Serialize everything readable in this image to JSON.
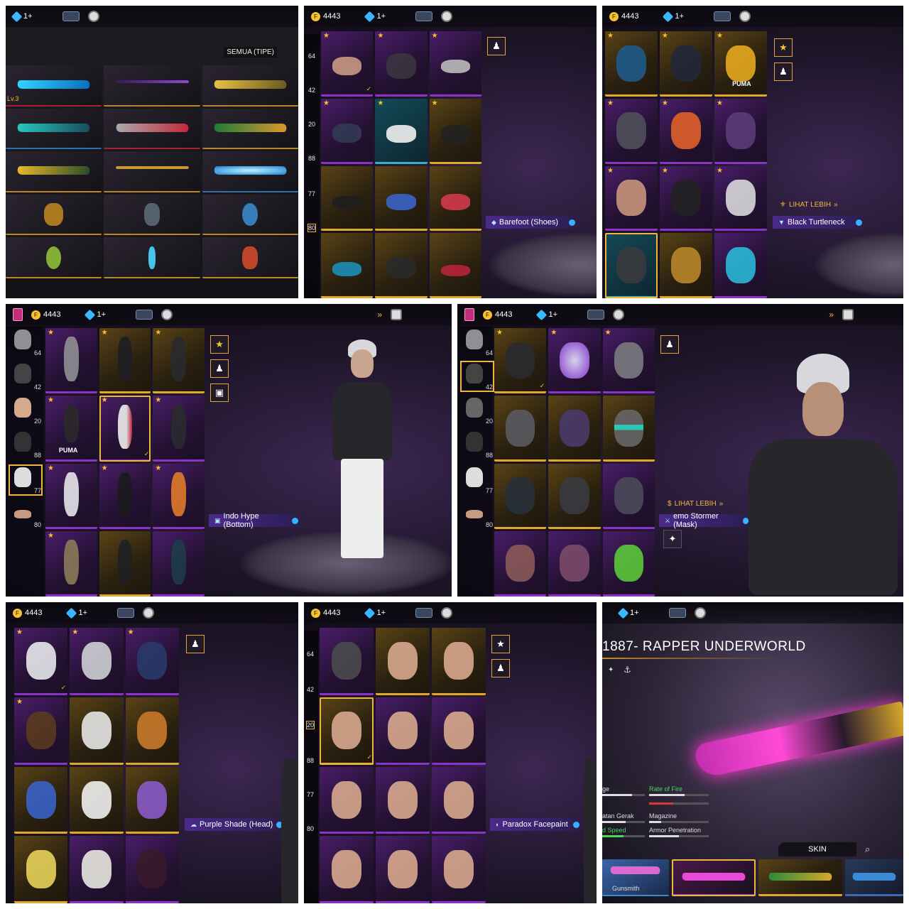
{
  "currency": {
    "coins": "4443",
    "gems": "1+",
    "coin_glyph": "F"
  },
  "panel1": {
    "filter_label": "SEMUA (TIPE)",
    "level_tag": "Lv.3"
  },
  "panel2": {
    "nums": [
      "64",
      "42",
      "20",
      "88",
      "77",
      "80"
    ],
    "selected_label": "Barefoot (Shoes)"
  },
  "panel3": {
    "see_more": "LIHAT LEBIH",
    "selected_label": "Black Turtleneck",
    "brand": "PUMA"
  },
  "panel4": {
    "nums": [
      "64",
      "42",
      "20",
      "88",
      "77",
      "80"
    ],
    "selected_label": "Indo Hype (Bottom)",
    "brand": "PUMA"
  },
  "panel5": {
    "nums": [
      "64",
      "42",
      "20",
      "88",
      "77",
      "80"
    ],
    "see_more": "LIHAT LEBIH",
    "selected_label": "emo Stormer (Mask)"
  },
  "panel7": {
    "nums": [
      "64",
      "42",
      "20",
      "88",
      "77",
      "80"
    ],
    "selected_label": "Paradox Facepaint"
  },
  "panel6": {
    "selected_label": "Purple Shade (Head)"
  },
  "panel9": {
    "weapon_title": "1887- RAPPER UNDERWORLD",
    "stats": {
      "left": [
        "ge",
        "",
        "atan Gerak",
        "d Speed"
      ],
      "right": [
        "Rate of Fire",
        "",
        "Magazine",
        "Armor Penetration"
      ]
    },
    "skin_tab": "SKIN",
    "gunsmith_label": "Gunsmith"
  },
  "colors": {
    "accent_gold": "#f0b53c",
    "rare_purple": "#8d31c9",
    "label_blue": "#4b2a89"
  }
}
